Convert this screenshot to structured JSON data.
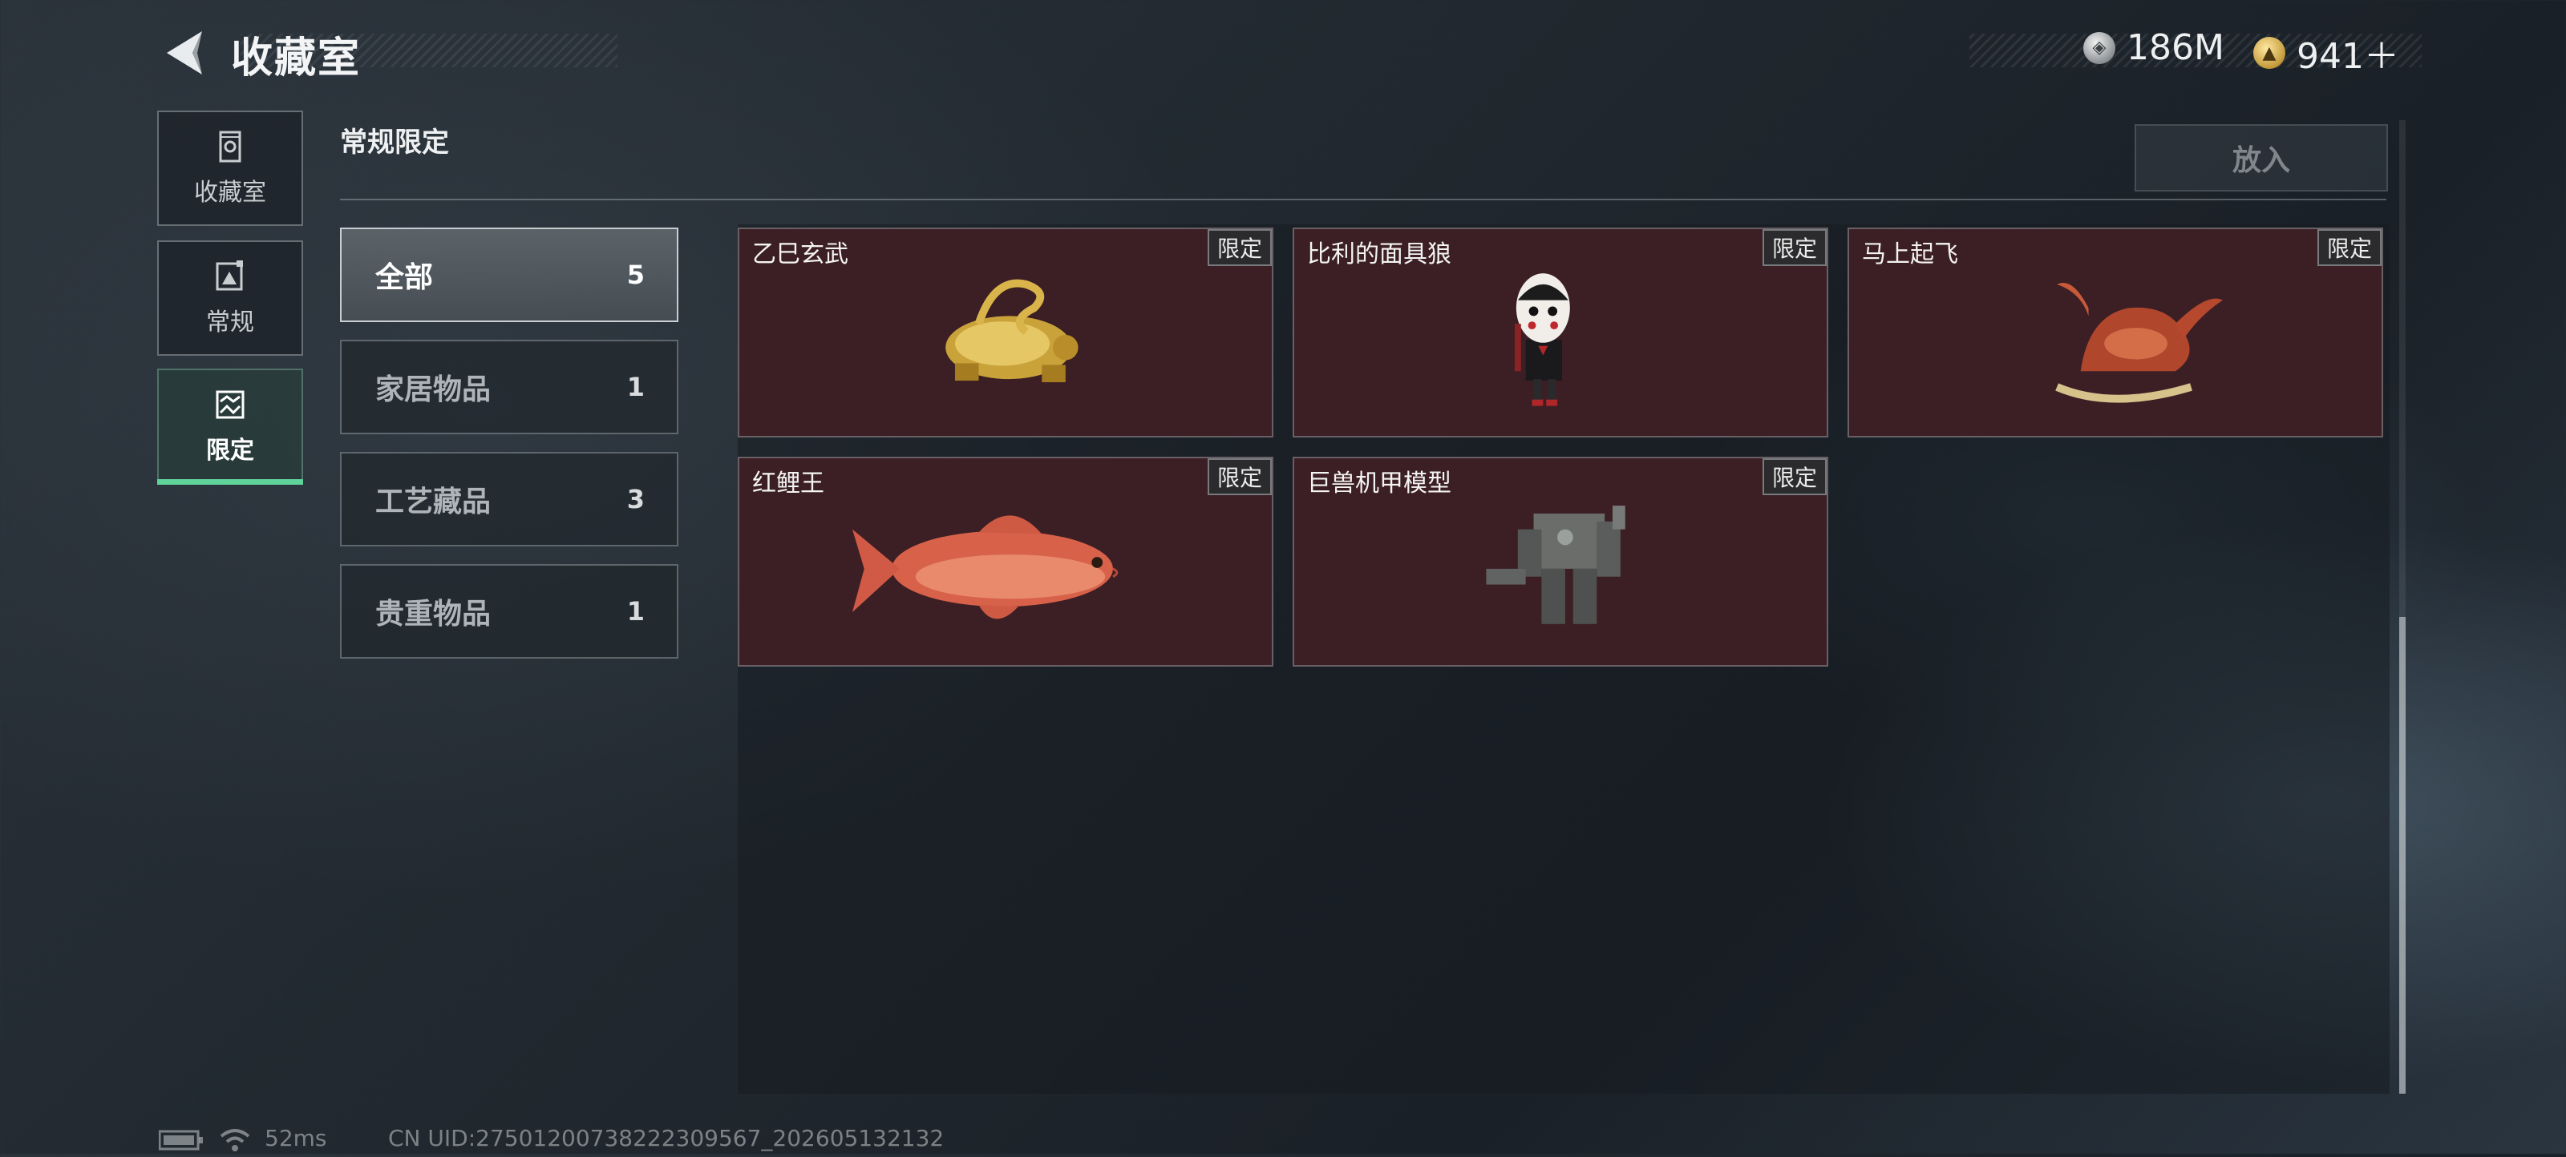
{
  "header": {
    "title": "收藏室",
    "back_icon": "back-arrow-icon",
    "currencies": [
      {
        "icon": "silver-coin-icon",
        "value": "186M"
      },
      {
        "icon": "gold-coin-icon",
        "value": "941＋"
      }
    ]
  },
  "rail": [
    {
      "label": "收藏室",
      "icon": "vault-icon",
      "active": false
    },
    {
      "label": "常规",
      "icon": "picture-icon",
      "active": false
    },
    {
      "label": "限定",
      "icon": "limited-icon",
      "active": true
    }
  ],
  "section": {
    "title": "常规限定",
    "put_button": "放入"
  },
  "categories": [
    {
      "label": "全部",
      "count": "5",
      "active": true
    },
    {
      "label": "家居物品",
      "count": "1",
      "active": false
    },
    {
      "label": "工艺藏品",
      "count": "3",
      "active": false
    },
    {
      "label": "贵重物品",
      "count": "1",
      "active": false
    }
  ],
  "items": [
    {
      "name": "乙巳玄武",
      "tag": "限定",
      "art": "gold-turtle-snake-statue"
    },
    {
      "name": "比利的面具狼",
      "tag": "限定",
      "art": "billy-puppet-figure"
    },
    {
      "name": "马上起飞",
      "tag": "限定",
      "art": "red-horse-rocker"
    },
    {
      "name": "红鲤王",
      "tag": "限定",
      "art": "red-carp"
    },
    {
      "name": "巨兽机甲模型",
      "tag": "限定",
      "art": "mech-model"
    }
  ],
  "footer": {
    "latency": "52ms",
    "uid": "CN UID:27501200738222309567_202605132132"
  },
  "colors": {
    "accent_green": "#5fd39a",
    "card_bg": "#3c1f24"
  }
}
